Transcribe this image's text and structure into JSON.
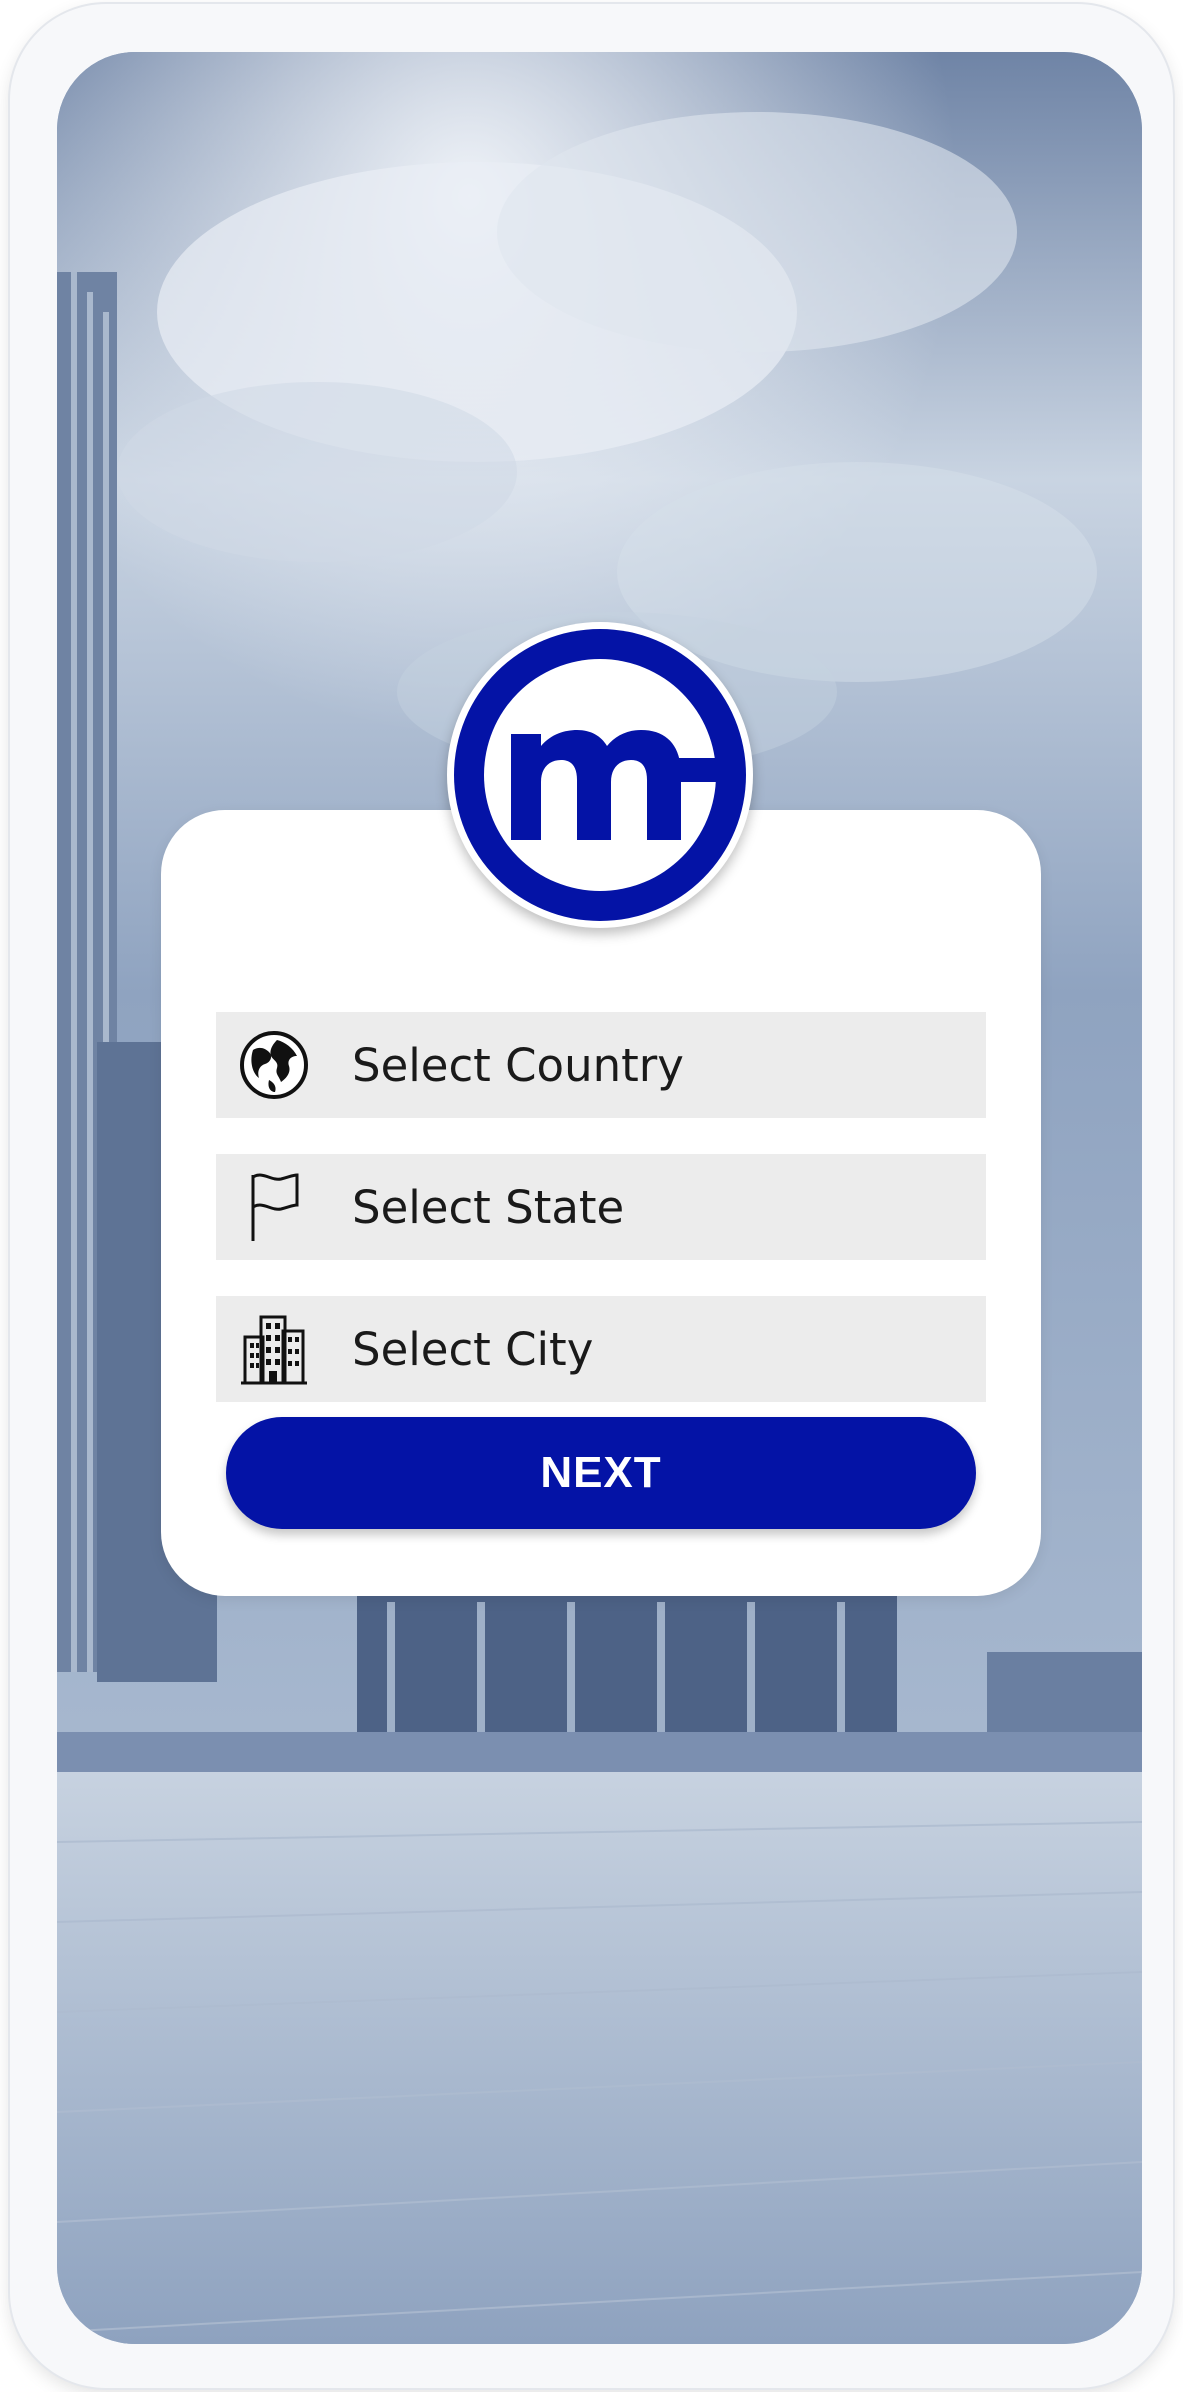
{
  "form": {
    "country": {
      "placeholder": "Select Country",
      "icon": "globe-icon"
    },
    "state": {
      "placeholder": "Select State",
      "icon": "flag-icon"
    },
    "city": {
      "placeholder": "Select City",
      "icon": "city-buildings-icon"
    }
  },
  "actions": {
    "next_label": "NEXT"
  },
  "logo": {
    "icon": "mc-logo-icon",
    "letters": "m"
  },
  "colors": {
    "brand": "#0413a6",
    "field_bg": "#ececec",
    "card_bg": "#ffffff"
  }
}
